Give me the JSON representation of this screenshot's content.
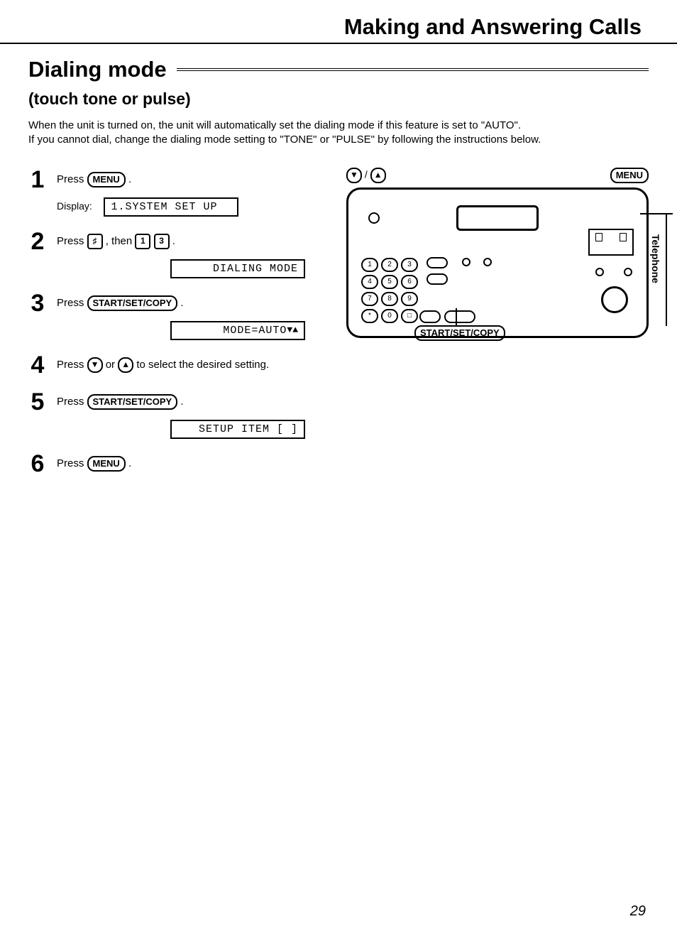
{
  "chapter_title": "Making and Answering Calls",
  "section_title": "Dialing mode",
  "subtitle": "(touch tone or pulse)",
  "intro_line1": "When the unit is turned on, the unit will automatically set the dialing mode if this feature is set to \"AUTO\".",
  "intro_line2": "If you cannot dial, change the dialing mode setting to \"TONE\" or \"PULSE\" by following the instructions below.",
  "display_label": "Display:",
  "steps": {
    "s1": {
      "n": "1",
      "press": "Press ",
      "btn": "MENU",
      "period": " .",
      "lcd": "1.SYSTEM SET UP"
    },
    "s2": {
      "n": "2",
      "press": "Press ",
      "k1": "♯",
      "then": " , then ",
      "k2": "1",
      "k3": "3",
      "period": " .",
      "lcd": "DIALING MODE"
    },
    "s3": {
      "n": "3",
      "press": "Press ",
      "btn": "START/SET/COPY",
      "period": " .",
      "lcd": "MODE=AUTO",
      "arrows": "▼▲"
    },
    "s4": {
      "n": "4",
      "press": "Press ",
      "down": "▼",
      "or": " or ",
      "up": "▲",
      "rest": " to select the desired setting."
    },
    "s5": {
      "n": "5",
      "press": "Press ",
      "btn": "START/SET/COPY",
      "period": " .",
      "lcd": "SETUP ITEM [  ]"
    },
    "s6": {
      "n": "6",
      "press": "Press ",
      "btn": "MENU",
      "period": " ."
    }
  },
  "callouts": {
    "arrows": "▼ / ▲",
    "menu": "MENU",
    "start": "START/SET/COPY"
  },
  "side_tab": "Telephone",
  "keypad": [
    "1",
    "2",
    "3",
    "4",
    "5",
    "6",
    "7",
    "8",
    "9",
    "*",
    "0",
    "□"
  ],
  "page_number": "29"
}
